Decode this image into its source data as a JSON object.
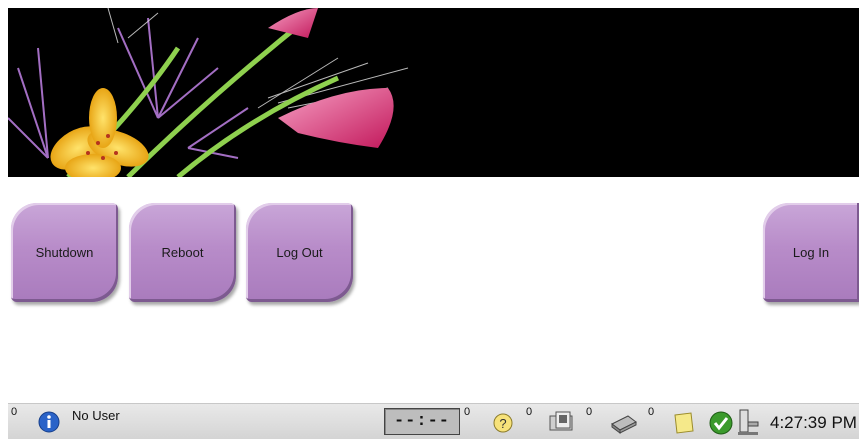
{
  "buttons": {
    "shutdown": "Shutdown",
    "reboot": "Reboot",
    "logout": "Log Out",
    "login": "Log In"
  },
  "statusbar": {
    "info_count": "0",
    "user": "No User",
    "exposure_timer": "--:--",
    "help_count": "0",
    "film_count": "0",
    "printer_count": "0",
    "notes_count": "0",
    "time": "4:27:39 PM",
    "icons": [
      "info-icon",
      "help-icon",
      "film-icon",
      "printer-icon",
      "notes-icon",
      "checkmark-icon",
      "detector-icon"
    ]
  },
  "colors": {
    "button_purple": "#b88cc9",
    "banner_bg": "#000000",
    "statusbar_bg": "#d9d9d9"
  }
}
